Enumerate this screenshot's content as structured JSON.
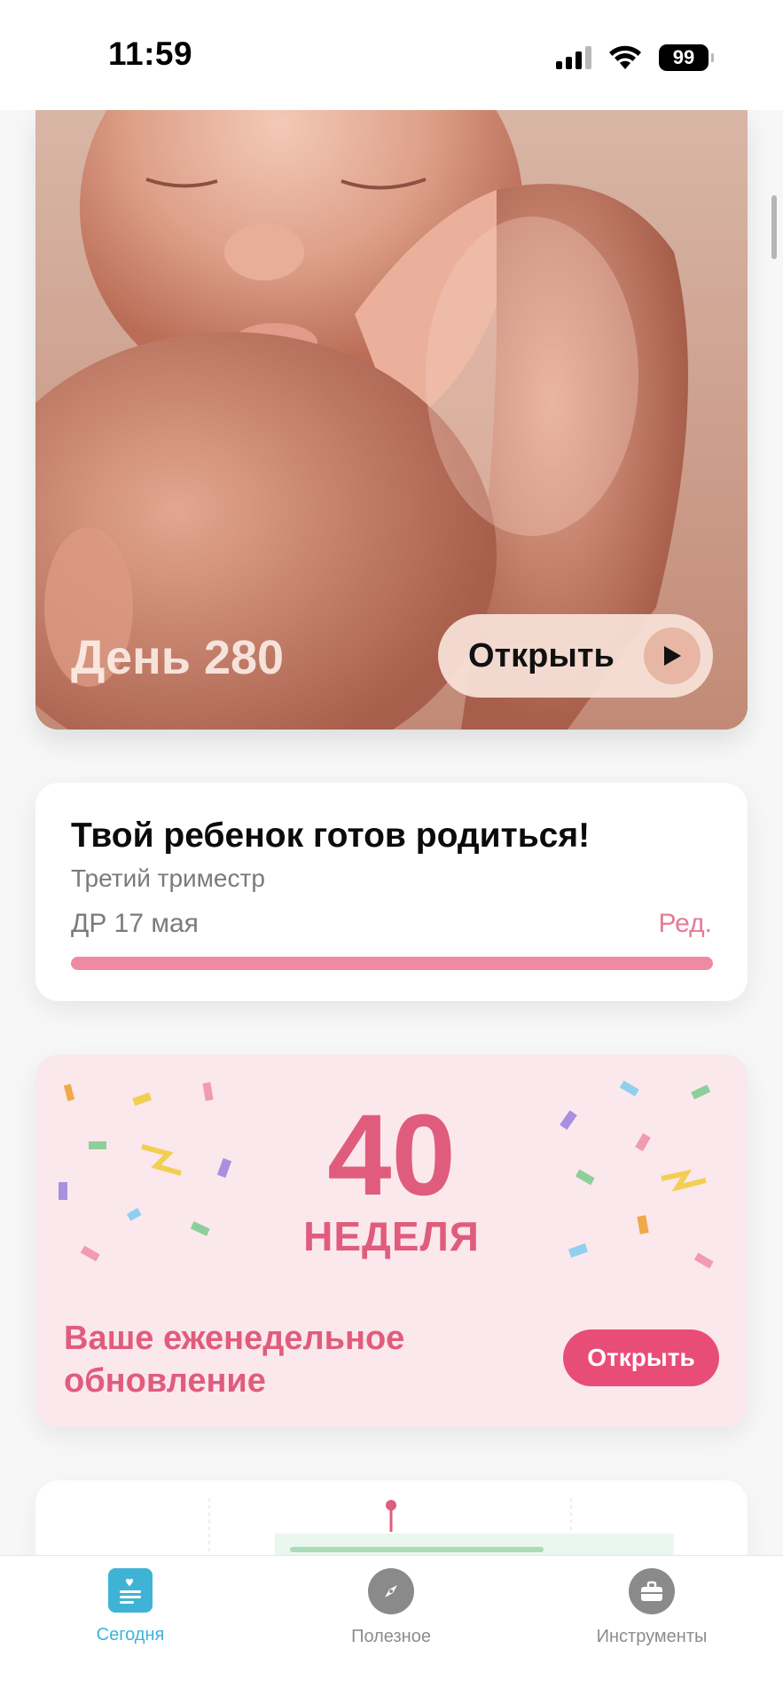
{
  "status_bar": {
    "time": "11:59",
    "battery": "99"
  },
  "hero": {
    "day_label": "День 280",
    "open_label": "Открыть"
  },
  "info_card": {
    "title": "Твой ребенок готов родиться!",
    "trimester": "Третий триместр",
    "due_date": "ДР 17 мая",
    "edit_label": "Ред.",
    "progress": 1.0
  },
  "week_card": {
    "number": "40",
    "label": "НЕДЕЛЯ",
    "update_text": "Ваше еженедельное обновление",
    "open_label": "Открыть"
  },
  "tab_bar": {
    "tabs": [
      {
        "label": "Сегодня",
        "icon": "journal-heart-icon",
        "active": true
      },
      {
        "label": "Полезное",
        "icon": "compass-icon",
        "active": false
      },
      {
        "label": "Инструменты",
        "icon": "briefcase-icon",
        "active": false
      }
    ]
  },
  "colors": {
    "accent_pink": "#e05c7d",
    "button_pink": "#e84d77",
    "progress_pink": "#ef8aa3",
    "tab_active": "#3fb3d6"
  }
}
